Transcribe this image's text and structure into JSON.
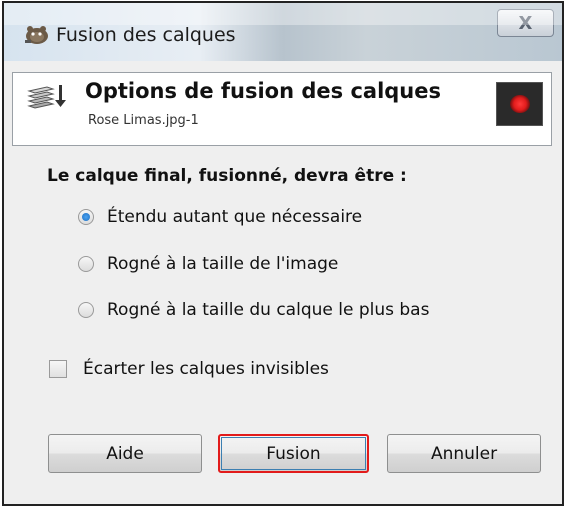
{
  "window": {
    "title": "Fusion des calques",
    "close_label": "X"
  },
  "header": {
    "title": "Options de fusion des calques",
    "subtitle": "Rose Limas.jpg-1"
  },
  "options": {
    "section_title": "Le calque final, fusionné, devra être :",
    "radios": [
      {
        "label": "Étendu autant que nécessaire",
        "checked": true
      },
      {
        "label": "Rogné à la taille de l'image",
        "checked": false
      },
      {
        "label": "Rogné à la taille du calque le plus bas",
        "checked": false
      }
    ],
    "checkbox": {
      "label": "Écarter les calques invisibles",
      "checked": false
    }
  },
  "buttons": {
    "help": "Aide",
    "merge": "Fusion",
    "cancel": "Annuler"
  },
  "colors": {
    "highlight_border": "#e21b1b",
    "radio_selected": "#1f6fc2",
    "preview_dot": "#e21c1c"
  }
}
